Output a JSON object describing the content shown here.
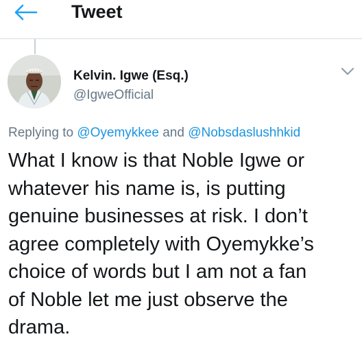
{
  "header": {
    "title": "Tweet",
    "back_icon": "arrow-left-icon",
    "accent": "#1da1f2"
  },
  "author": {
    "name": "Kelvin. Igwe (Esq.)",
    "handle": "@IgweOfficial"
  },
  "menu_icon": "chevron-down-icon",
  "reply": {
    "prefix": "Replying to ",
    "mention1": "@Oyemykkee",
    "connector": " and ",
    "mention2": "@Nobsdaslushhkid",
    "mention_color": "#1b95e0"
  },
  "tweet": {
    "lines": [
      "What I know is that Noble Igwe or",
      "whatever his name is, is putting",
      "genuine businesses at risk. I don’t",
      "agree completely with Oyemykke’s",
      "choice of words but I am not a fan",
      "of Noble let me just observe the",
      "drama."
    ]
  }
}
